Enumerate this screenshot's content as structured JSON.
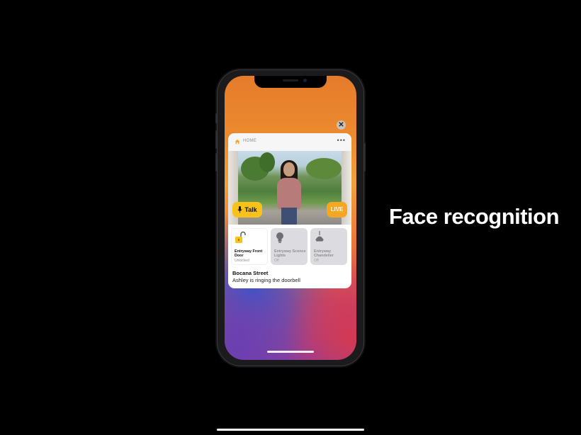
{
  "slide": {
    "caption": "Face recognition"
  },
  "notification": {
    "app_name": "HOME",
    "app_icon": "home-icon",
    "more_label": "•••",
    "close_label": "✕",
    "camera": {
      "talk_label": "Talk",
      "live_label": "LIVE",
      "talk_icon": "microphone-icon"
    },
    "accessories": [
      {
        "name": "Entryway Front Door",
        "status": "Unlocked",
        "icon": "unlocked-lock-icon",
        "active": true
      },
      {
        "name": "Entryway Sconce Lights",
        "status": "Off",
        "icon": "lightbulb-icon",
        "active": false
      },
      {
        "name": "Entryway Chandelier",
        "status": "Off",
        "icon": "pendant-lamp-icon",
        "active": false
      }
    ],
    "title": "Bocana Street",
    "body": "Ashley is ringing the doorbell"
  },
  "colors": {
    "accent_yellow": "#f8c21a",
    "live_orange": "#f5a623",
    "background": "#000000"
  }
}
